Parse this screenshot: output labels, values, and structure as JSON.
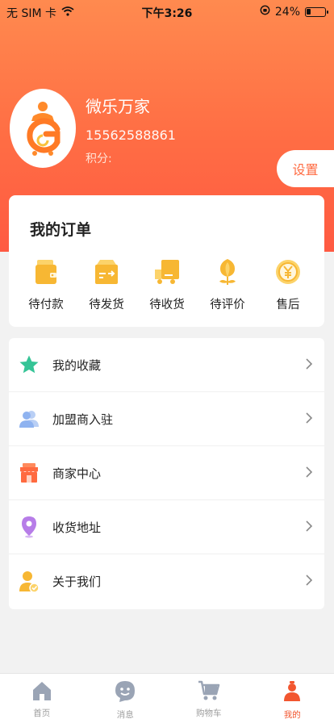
{
  "status_bar": {
    "carrier": "无 SIM 卡",
    "time": "下午3:26",
    "battery": "24%",
    "battery_level": 0.24
  },
  "profile": {
    "name": "微乐万家",
    "phone": "15562588861",
    "points_label": "积分:",
    "settings_label": "设置"
  },
  "orders": {
    "title": "我的订单",
    "items": [
      {
        "label": "待付款",
        "icon": "wallet-icon"
      },
      {
        "label": "待发货",
        "icon": "package-icon"
      },
      {
        "label": "待收货",
        "icon": "truck-icon"
      },
      {
        "label": "待评价",
        "icon": "flower-icon"
      },
      {
        "label": "售后",
        "icon": "yen-coin-icon"
      }
    ]
  },
  "menu": {
    "items": [
      {
        "label": "我的收藏",
        "icon": "star-icon"
      },
      {
        "label": "加盟商入驻",
        "icon": "users-icon"
      },
      {
        "label": "商家中心",
        "icon": "shop-icon"
      },
      {
        "label": "收货地址",
        "icon": "location-pin-icon"
      },
      {
        "label": "关于我们",
        "icon": "user-badge-icon"
      }
    ]
  },
  "tabbar": {
    "items": [
      {
        "label": "首页",
        "icon": "home-icon"
      },
      {
        "label": "消息",
        "icon": "message-icon"
      },
      {
        "label": "购物车",
        "icon": "cart-icon"
      },
      {
        "label": "我的",
        "icon": "profile-icon"
      }
    ],
    "active_index": 3
  },
  "colors": {
    "accent": "#ff6a40",
    "tab_active": "#f2562f",
    "order_icon": "#f7b733",
    "star": "#35c496",
    "users": "#8fb3f0",
    "shop": "#ff6a40",
    "location": "#b77de8",
    "about": "#f7b733"
  }
}
